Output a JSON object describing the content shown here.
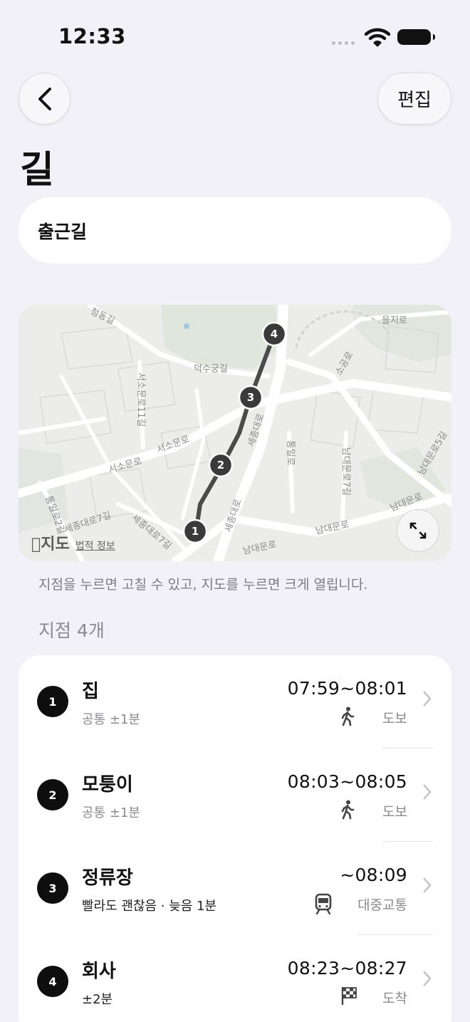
{
  "status_bar": {
    "time": "12:33"
  },
  "nav": {
    "edit_label": "편집"
  },
  "page": {
    "title": "길"
  },
  "route": {
    "name": "출근길"
  },
  "map": {
    "streets": [
      "청동길",
      "을지로",
      "덕수궁길",
      "서소문로11길",
      "서소문로",
      "서소문로",
      "세종대로",
      "세종대로",
      "소공로",
      "남대문로",
      "남대문로",
      "남대문로",
      "남대문로5길",
      "남대문로7길",
      "통일로",
      "통일로2길",
      "세종대로7길"
    ],
    "markers": [
      "1",
      "2",
      "3",
      "4"
    ],
    "brand": "지도",
    "legal": "법적 정보"
  },
  "hint": "지점을 누르면 고칠 수 있고, 지도를 누르면 크게 열립니다.",
  "stops_header": "지점 4개",
  "stops": [
    {
      "number": "1",
      "name": "집",
      "sub": "공통 ±1분",
      "time": "07:59~08:01",
      "mode_icon": "walk-icon",
      "mode": "도보"
    },
    {
      "number": "2",
      "name": "모퉁이",
      "sub": "공통 ±1분",
      "time": "08:03~08:05",
      "mode_icon": "walk-icon",
      "mode": "도보"
    },
    {
      "number": "3",
      "name": "정류장",
      "sub": "빨라도 괜찮음 · 늦음 1분",
      "time": "~08:09",
      "mode_icon": "tram-icon",
      "mode": "대중교통"
    },
    {
      "number": "4",
      "name": "회사",
      "sub": "±2분",
      "time": "08:23~08:27",
      "mode_icon": "checkered-flag-icon",
      "mode": "도착"
    }
  ]
}
